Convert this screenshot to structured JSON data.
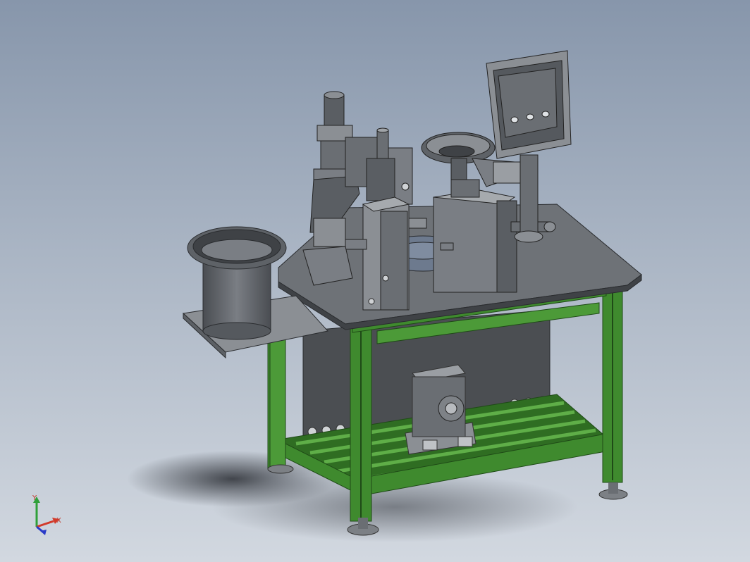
{
  "viewport": {
    "background_top": "#8796ab",
    "background_bottom": "#d2d8e0"
  },
  "model": {
    "frame_color": "#3f8a2e",
    "frame_edge_color": "#1f4a17",
    "table_color": "#6e7277",
    "part_color": "#5a5e63",
    "part_dark": "#3c3f43",
    "part_light": "#8b8f94"
  },
  "triad": {
    "x_label": "X",
    "y_label": "Y",
    "x_color": "#d23a2a",
    "y_color": "#2fa03a",
    "z_color": "#2a3bc8",
    "x_icon": "axis-x-arrow-icon",
    "y_icon": "axis-y-arrow-icon",
    "z_icon": "axis-z-arrow-icon"
  }
}
